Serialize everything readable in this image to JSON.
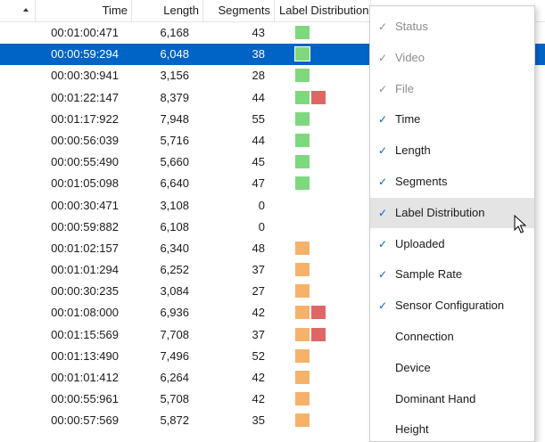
{
  "columns": {
    "time": "Time",
    "length": "Length",
    "segments": "Segments",
    "label_distribution": "Label Distribution",
    "sensor_config": "Sensor Configuration"
  },
  "colors": {
    "selection": "#0063c6",
    "green": "#7ed87e",
    "orange": "#f6b26b",
    "red": "#e06666",
    "check": "#0063c6",
    "hover": "#e4e4e4"
  },
  "rows": [
    {
      "time": "00:01:00:471",
      "length": "6,168",
      "segments": "43",
      "labels": [
        "green"
      ],
      "selected": false
    },
    {
      "time": "00:00:59:294",
      "length": "6,048",
      "segments": "38",
      "labels": [
        "green"
      ],
      "selected": true
    },
    {
      "time": "00:00:30:941",
      "length": "3,156",
      "segments": "28",
      "labels": [
        "green"
      ],
      "selected": false
    },
    {
      "time": "00:01:22:147",
      "length": "8,379",
      "segments": "44",
      "labels": [
        "green",
        "red"
      ],
      "selected": false
    },
    {
      "time": "00:01:17:922",
      "length": "7,948",
      "segments": "55",
      "labels": [
        "green"
      ],
      "selected": false
    },
    {
      "time": "00:00:56:039",
      "length": "5,716",
      "segments": "44",
      "labels": [
        "green"
      ],
      "selected": false
    },
    {
      "time": "00:00:55:490",
      "length": "5,660",
      "segments": "45",
      "labels": [
        "green"
      ],
      "selected": false
    },
    {
      "time": "00:01:05:098",
      "length": "6,640",
      "segments": "47",
      "labels": [
        "green"
      ],
      "selected": false
    },
    {
      "time": "00:00:30:471",
      "length": "3,108",
      "segments": "0",
      "labels": [],
      "selected": false
    },
    {
      "time": "00:00:59:882",
      "length": "6,108",
      "segments": "0",
      "labels": [],
      "selected": false
    },
    {
      "time": "00:01:02:157",
      "length": "6,340",
      "segments": "48",
      "labels": [
        "orange"
      ],
      "selected": false
    },
    {
      "time": "00:01:01:294",
      "length": "6,252",
      "segments": "37",
      "labels": [
        "orange"
      ],
      "selected": false
    },
    {
      "time": "00:00:30:235",
      "length": "3,084",
      "segments": "27",
      "labels": [
        "orange"
      ],
      "selected": false
    },
    {
      "time": "00:01:08:000",
      "length": "6,936",
      "segments": "42",
      "labels": [
        "orange",
        "red"
      ],
      "selected": false
    },
    {
      "time": "00:01:15:569",
      "length": "7,708",
      "segments": "37",
      "labels": [
        "orange",
        "red"
      ],
      "selected": false
    },
    {
      "time": "00:01:13:490",
      "length": "7,496",
      "segments": "52",
      "labels": [
        "orange"
      ],
      "selected": false
    },
    {
      "time": "00:01:01:412",
      "length": "6,264",
      "segments": "42",
      "labels": [
        "orange"
      ],
      "selected": false
    },
    {
      "time": "00:00:55:961",
      "length": "5,708",
      "segments": "42",
      "labels": [
        "orange"
      ],
      "selected": false
    },
    {
      "time": "00:00:57:569",
      "length": "5,872",
      "segments": "35",
      "labels": [
        "orange"
      ],
      "selected": false
    }
  ],
  "menu": {
    "items": [
      {
        "label": "Status",
        "checked": true,
        "disabled": true,
        "hover": false
      },
      {
        "label": "Video",
        "checked": true,
        "disabled": true,
        "hover": false
      },
      {
        "label": "File",
        "checked": true,
        "disabled": true,
        "hover": false
      },
      {
        "label": "Time",
        "checked": true,
        "disabled": false,
        "hover": false
      },
      {
        "label": "Length",
        "checked": true,
        "disabled": false,
        "hover": false
      },
      {
        "label": "Segments",
        "checked": true,
        "disabled": false,
        "hover": false
      },
      {
        "label": "Label Distribution",
        "checked": true,
        "disabled": false,
        "hover": true
      },
      {
        "label": "Uploaded",
        "checked": true,
        "disabled": false,
        "hover": false
      },
      {
        "label": "Sample Rate",
        "checked": true,
        "disabled": false,
        "hover": false
      },
      {
        "label": "Sensor Configuration",
        "checked": true,
        "disabled": false,
        "hover": false
      },
      {
        "label": "Connection",
        "checked": false,
        "disabled": false,
        "hover": false
      },
      {
        "label": "Device",
        "checked": false,
        "disabled": false,
        "hover": false
      },
      {
        "label": "Dominant Hand",
        "checked": false,
        "disabled": false,
        "hover": false
      },
      {
        "label": "Height",
        "checked": false,
        "disabled": false,
        "hover": false
      }
    ],
    "check_glyph": "✓"
  }
}
